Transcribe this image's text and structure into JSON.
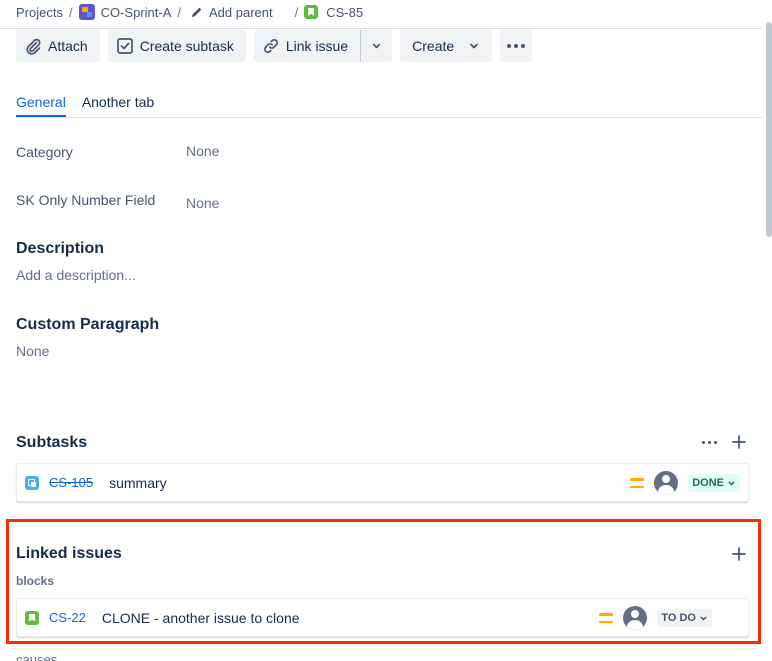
{
  "breadcrumb": {
    "projects": "Projects",
    "project": "CO-Sprint-A",
    "add_parent": "Add parent",
    "issue_key": "CS-85",
    "separator": "/"
  },
  "toolbar": {
    "attach": "Attach",
    "create_subtask": "Create subtask",
    "link_issue": "Link issue",
    "create": "Create"
  },
  "tabs": [
    {
      "label": "General",
      "active": true
    },
    {
      "label": "Another tab",
      "active": false
    }
  ],
  "fields": {
    "category": {
      "label": "Category",
      "value": "None"
    },
    "sk_only_number": {
      "label": "SK Only Number Field",
      "value": "None"
    }
  },
  "description": {
    "title": "Description",
    "placeholder": "Add a description..."
  },
  "custom_paragraph": {
    "title": "Custom Paragraph",
    "value": "None"
  },
  "subtasks": {
    "title": "Subtasks",
    "items": [
      {
        "key": "CS-105",
        "summary": "summary",
        "status": "DONE",
        "priority": "medium"
      }
    ]
  },
  "linked_issues": {
    "title": "Linked issues",
    "groups": [
      {
        "relation": "blocks",
        "items": [
          {
            "key": "CS-22",
            "summary": "CLONE - another issue to clone",
            "status": "TO DO",
            "priority": "medium"
          }
        ]
      }
    ],
    "next_relation_partial": "causes"
  },
  "colors": {
    "link": "#0c66e4",
    "highlight": "#ff2a00",
    "done_bg": "#dcfff1",
    "priority_medium": "#ffab00"
  }
}
